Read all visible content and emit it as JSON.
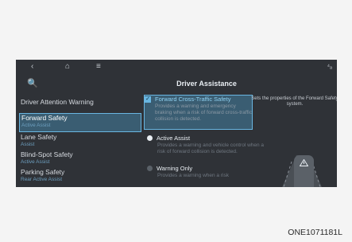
{
  "topbar": {
    "back": "‹",
    "home": "⌂",
    "menu": "≡",
    "status": "⁴ₐ"
  },
  "search_icon": "🔍",
  "title": "Driver Assistance",
  "left": {
    "section": "Driver Attention Warning",
    "items": [
      {
        "label": "Forward Safety",
        "sub": "Active Assist"
      },
      {
        "label": "Lane Safety",
        "sub": "Assist"
      },
      {
        "label": "Blind-Spot Safety",
        "sub": "Active Assist"
      },
      {
        "label": "Parking Safety",
        "sub": "Rear Active Assist"
      }
    ]
  },
  "options": [
    {
      "label": "Forward Cross-Traffic Safety",
      "desc": "Provides a warning and emergency braking when a risk of forward cross-traffic collision is detected."
    },
    {
      "label": "Active Assist",
      "desc": "Provides a warning and vehicle control when a risk of forward collision is detected."
    },
    {
      "label": "Warning Only",
      "desc": "Provides a warning when a risk"
    }
  ],
  "right": {
    "info": "Sets the properties of the Forward Safety system."
  },
  "code": "ONE1071181L"
}
